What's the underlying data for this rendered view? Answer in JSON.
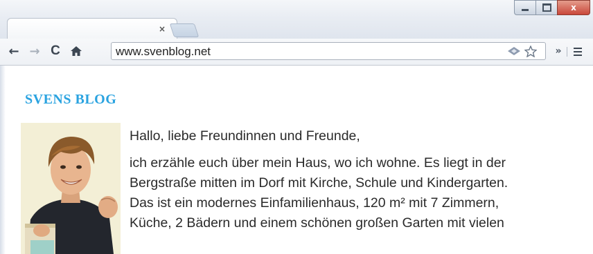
{
  "browser": {
    "tab": {
      "title": "",
      "close_glyph": "×"
    },
    "window_controls": {
      "close_glyph": "x"
    },
    "toolbar": {
      "back_glyph": "←",
      "forward_glyph": "→",
      "reload_glyph": "C",
      "home_glyph": "⌂",
      "url": "www.svenblog.net",
      "extensions_glyph": "»"
    },
    "icons": [
      "back-icon",
      "forward-icon",
      "reload-icon",
      "home-icon",
      "page-action-icon",
      "star-icon",
      "extensions-icon",
      "menu-icon",
      "close-icon",
      "minimize-icon",
      "maximize-icon"
    ]
  },
  "page": {
    "blog_title": "SVENS BLOG",
    "greeting": "Hallo, liebe Freundinnen und Freunde,",
    "paragraph_lines": [
      "ich erzähle euch über mein Haus, wo ich wohne. Es liegt in der",
      "Bergstraße mitten im Dorf mit Kirche, Schule und Kindergarten.",
      "Das ist ein modernes Einfamilienhaus, 120 m² mit 7 Zimmern,",
      "Küche, 2 Bädern und einem schönen großen Garten mit vielen"
    ]
  },
  "colors": {
    "blog_title": "#2aa3e0",
    "text": "#2a2a2a",
    "close_button": "#c9473a"
  }
}
